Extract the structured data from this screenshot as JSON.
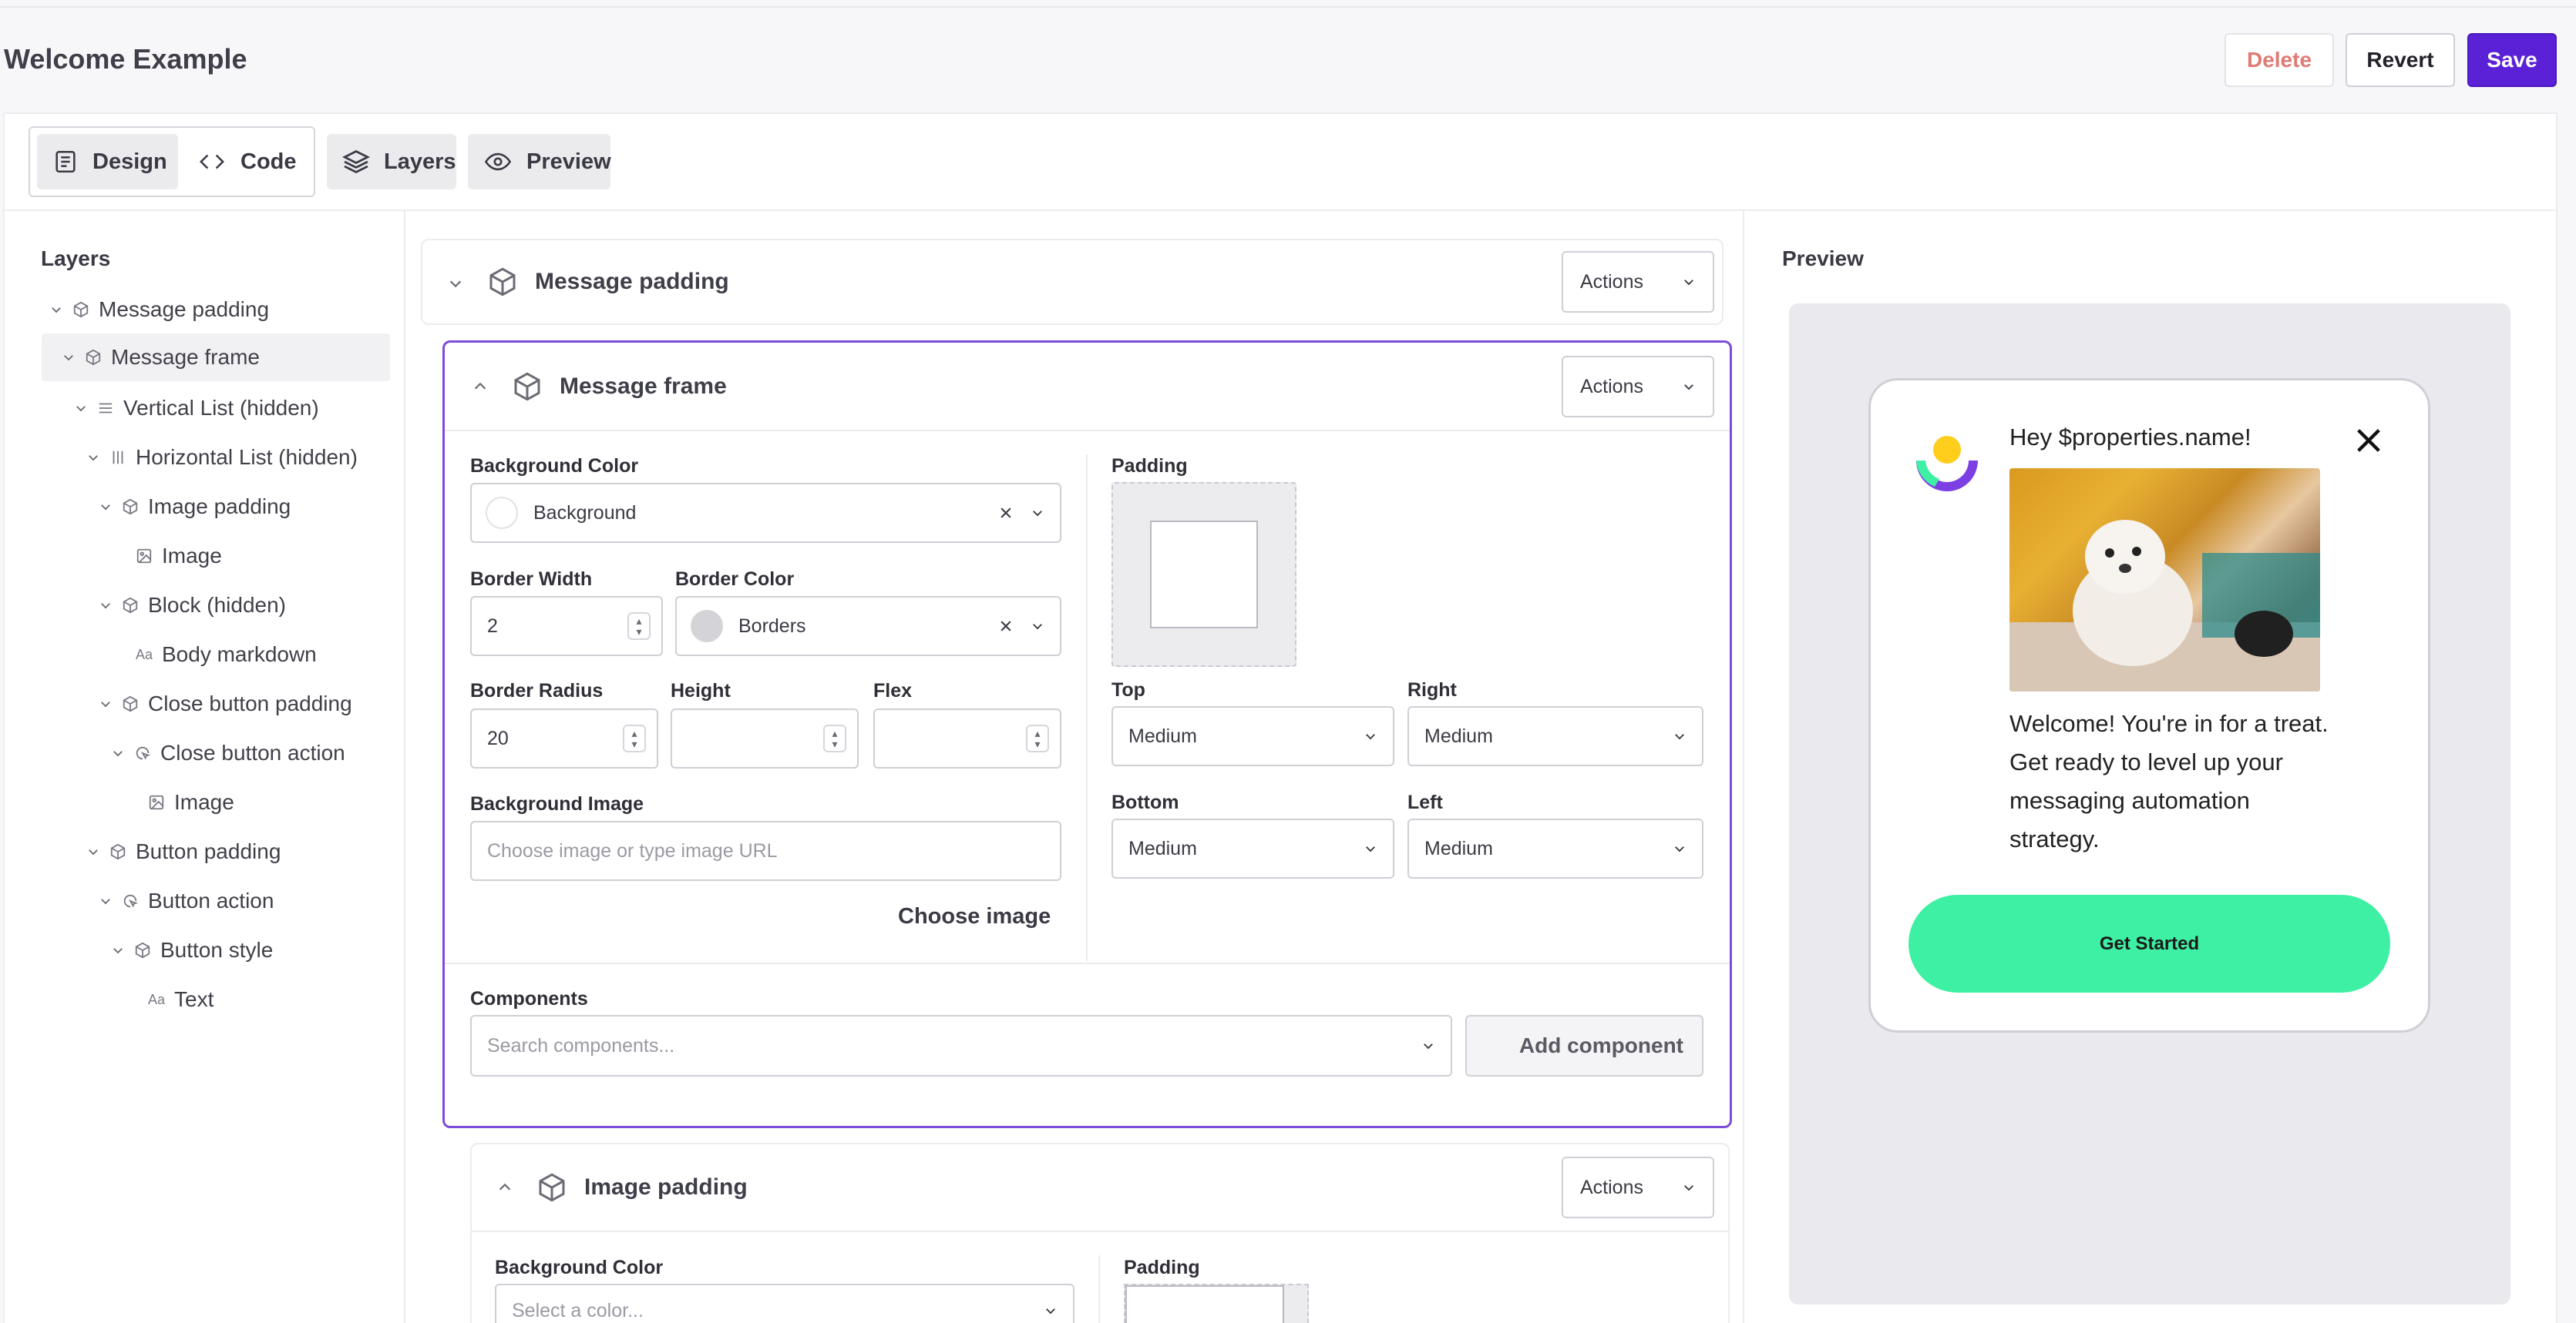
{
  "header": {
    "title": "Welcome Example",
    "delete_label": "Delete",
    "revert_label": "Revert",
    "save_label": "Save"
  },
  "toolbar": {
    "design_label": "Design",
    "code_label": "Code",
    "layers_label": "Layers",
    "preview_label": "Preview"
  },
  "layers": {
    "title": "Layers",
    "items": [
      {
        "label": "Message padding"
      },
      {
        "label": "Message frame"
      },
      {
        "label": "Vertical List (hidden)"
      },
      {
        "label": "Horizontal List (hidden)"
      },
      {
        "label": "Image padding"
      },
      {
        "label": "Image"
      },
      {
        "label": "Block (hidden)"
      },
      {
        "label": "Body markdown"
      },
      {
        "label": "Close button padding"
      },
      {
        "label": "Close button action"
      },
      {
        "label": "Image"
      },
      {
        "label": "Button padding"
      },
      {
        "label": "Button action"
      },
      {
        "label": "Button style"
      },
      {
        "label": "Text"
      }
    ]
  },
  "editor": {
    "message_padding_title": "Message padding",
    "message_frame_title": "Message frame",
    "image_padding_title": "Image padding",
    "actions_label": "Actions",
    "bg_color_label": "Background Color",
    "bg_color_value": "Background",
    "border_width_label": "Border Width",
    "border_width_value": "2",
    "border_color_label": "Border Color",
    "border_color_value": "Borders",
    "border_radius_label": "Border Radius",
    "border_radius_value": "20",
    "height_label": "Height",
    "flex_label": "Flex",
    "bg_image_label": "Background Image",
    "bg_image_placeholder": "Choose image or type image URL",
    "choose_image_label": "Choose image",
    "padding_label": "Padding",
    "top_label": "Top",
    "top_value": "Medium",
    "right_label": "Right",
    "right_value": "Medium",
    "bottom_label": "Bottom",
    "bottom_value": "Medium",
    "left_label": "Left",
    "left_value": "Medium",
    "components_label": "Components",
    "components_placeholder": "Search components...",
    "add_component_label": "Add component",
    "select_color_placeholder": "Select a color..."
  },
  "preview": {
    "label": "Preview",
    "heading": "Hey $properties.name!",
    "body": "Welcome! You're in for a treat. Get ready to level up your messaging automation strategy.",
    "cta": "Get Started"
  },
  "colors": {
    "accent": "#5b21d6",
    "selected_border": "#7c4ddb",
    "cta": "#3ef0a3",
    "delete_text": "#e07a74"
  }
}
